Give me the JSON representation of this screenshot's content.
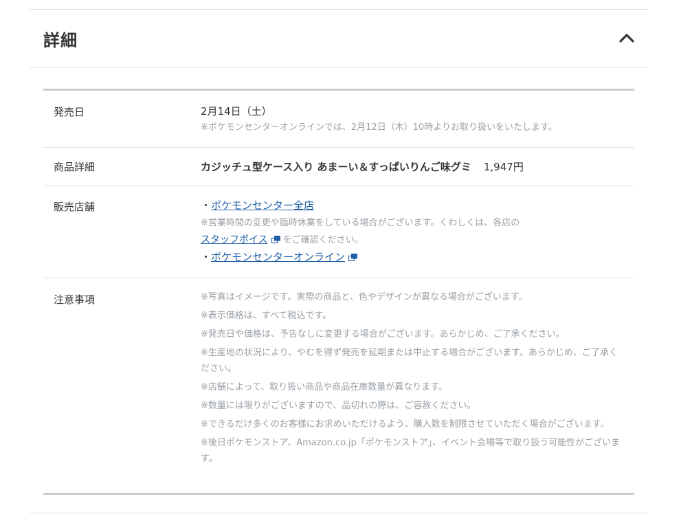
{
  "section": {
    "title": "詳細",
    "toggle_icon": "chevron-up-icon"
  },
  "details": {
    "release": {
      "label": "発売日",
      "date": "2月14日（土）",
      "note": "※ポケモンセンターオンラインでは、2月12日（木）10時よりお取り扱いをいたします。"
    },
    "product": {
      "label": "商品詳細",
      "name": "カジッチュ型ケース入り あまーい＆すっぱいりんご味グミ",
      "price": "1,947円"
    },
    "store": {
      "label": "販売店舗",
      "bullet": "・",
      "link1": "ポケモンセンター全店",
      "note1": "※営業時間の変更や臨時休業をしている場合がございます。くわしくは、各店の",
      "link2": "スタッフボイス",
      "note2": "をご確認ください。",
      "link3": "ポケモンセンターオンライン"
    },
    "notice": {
      "label": "注意事項",
      "items": [
        "※写真はイメージです。実際の商品と、色やデザインが異なる場合がございます。",
        "※表示価格は、すべて税込です。",
        "※発売日や価格は、予告なしに変更する場合がございます。あらかじめ、ご了承ください。",
        "※生産地の状況により、やむを得ず発売を延期または中止する場合がございます。あらかじめ、ご了承ください。",
        "※店舗によって、取り扱い商品や商品在庫数量が異なります。",
        "※数量には限りがございますので、品切れの際は、ご容赦ください。",
        "※できるだけ多くのお客様にお求めいただけるよう、購入数を制限させていただく場合がございます。",
        "※後日ポケモンストア、Amazon.co.jp「ポケモンストア」、イベント会場等で取り扱う可能性がございます。"
      ]
    }
  },
  "colors": {
    "link": "#1f5fa8",
    "note": "#9aa0a6",
    "text": "#333333"
  }
}
